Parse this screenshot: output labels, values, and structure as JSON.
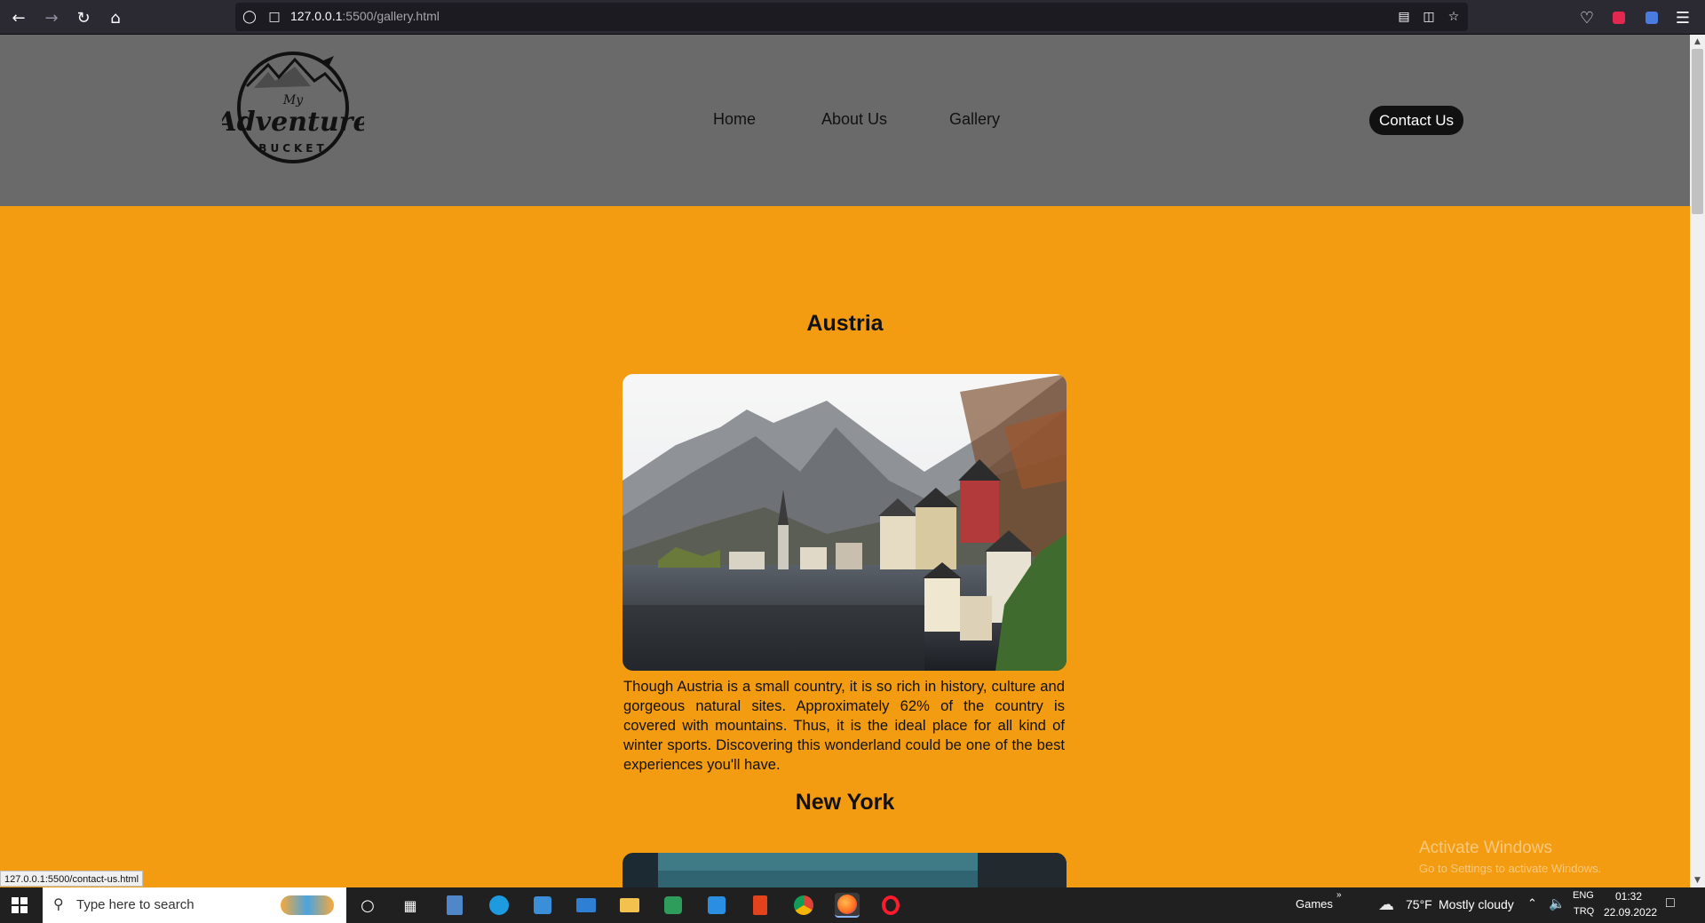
{
  "browser": {
    "url_host": "127.0.0.1",
    "url_rest": ":5500/gallery.html",
    "status_tooltip": "127.0.0.1:5500/contact-us.html"
  },
  "site": {
    "logo_text_my": "My",
    "logo_text_main": "Adventure",
    "logo_text_bucket": "BUCKET",
    "nav": {
      "home": "Home",
      "about": "About Us",
      "gallery": "Gallery",
      "contact": "Contact Us"
    }
  },
  "gallery": {
    "sections": [
      {
        "title": "Austria",
        "description": "Though Austria is a small country, it is so rich in history, culture and gorgeous natural sites. Approximately 62% of the country is covered with mountains. Thus, it is the ideal place for all kind of winter sports. Discovering this wonderland could be one of the best experiences you'll have."
      },
      {
        "title": "New York"
      }
    ]
  },
  "watermark": {
    "line1": "Activate Windows",
    "line2": "Go to Settings to activate Windows."
  },
  "taskbar": {
    "search_placeholder": "Type here to search",
    "games_label": "Games",
    "weather_temp": "75°F",
    "weather_desc": "Mostly cloudy",
    "lang_top": "ENG",
    "lang_bottom": "TRQ",
    "time": "01:32",
    "date": "22.09.2022"
  },
  "colors": {
    "page_bg": "#f39c11",
    "header_bg": "#6b6a6a",
    "contact_btn": "#111111"
  }
}
